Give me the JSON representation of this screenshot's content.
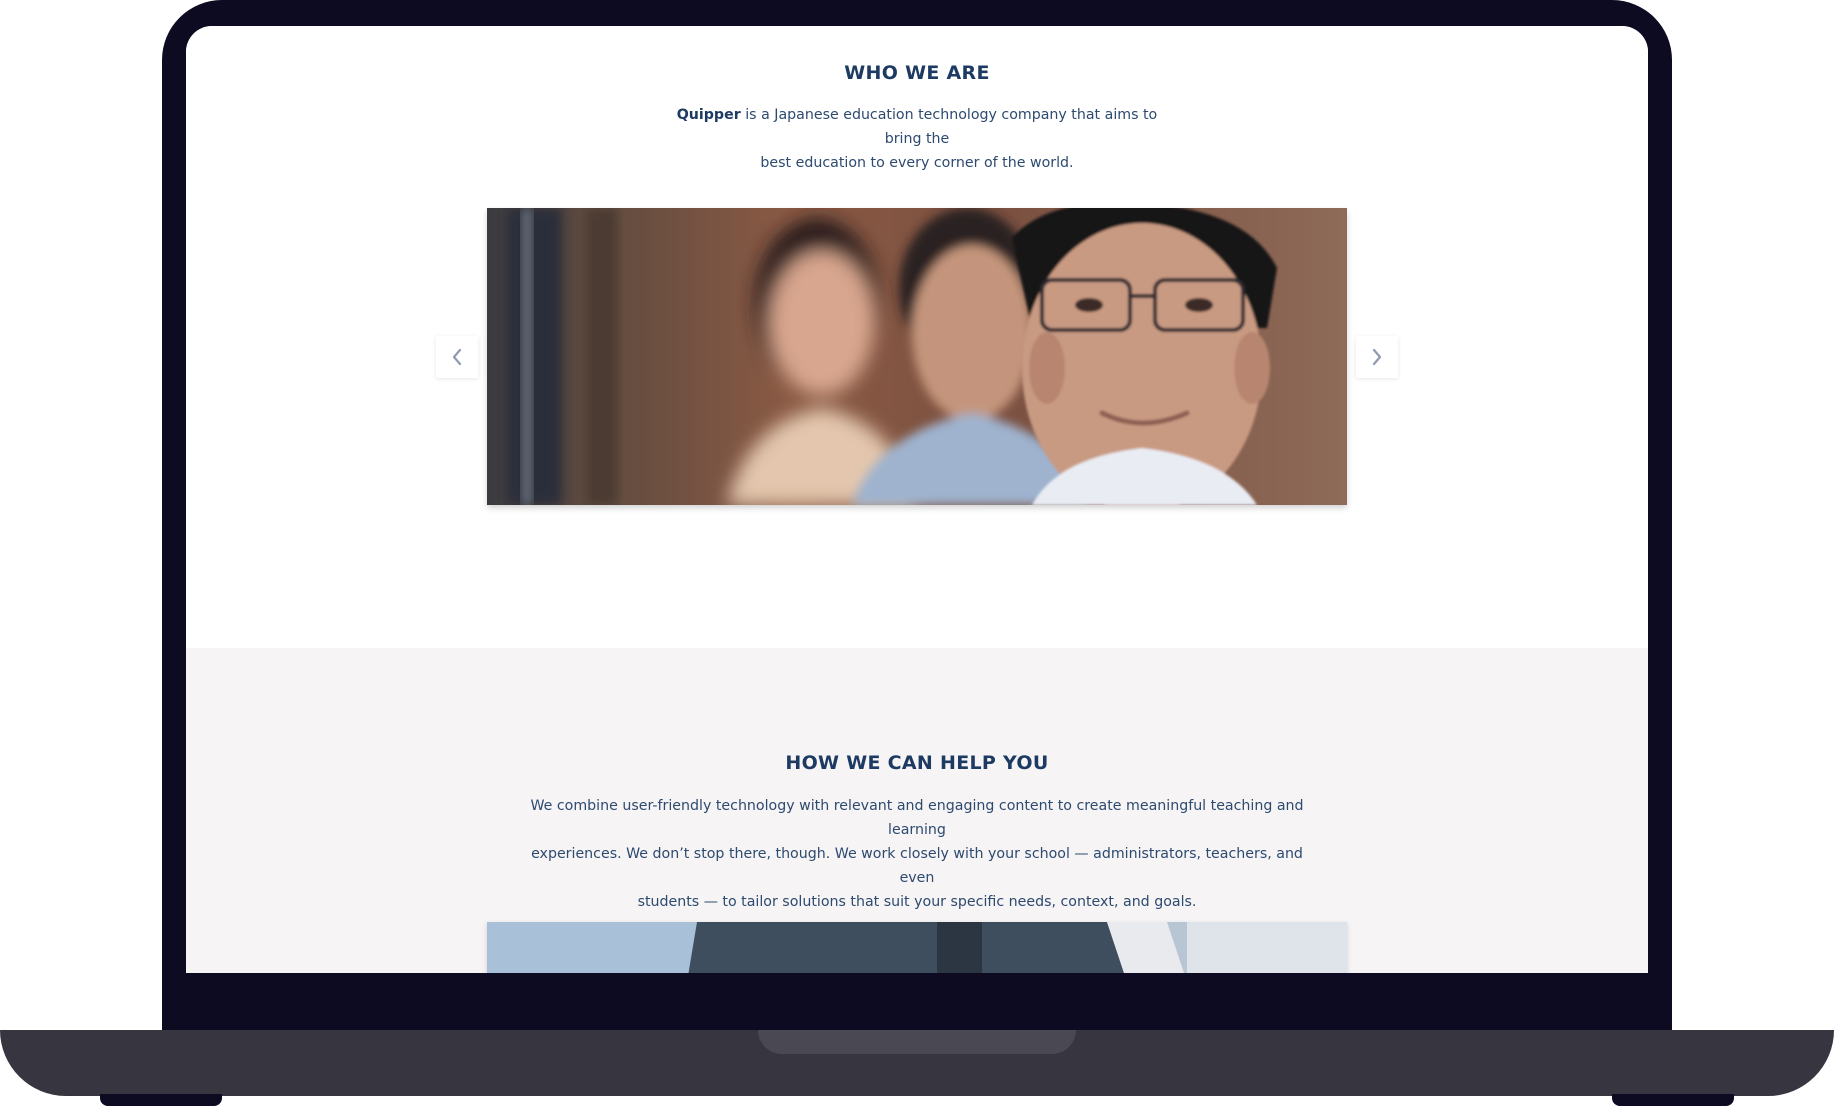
{
  "who_we_are": {
    "title": "WHO WE ARE",
    "brand": "Quipper",
    "description_line1": "is a Japanese education technology company that aims to bring the",
    "description_line2": "best education to every corner of the world.",
    "carousel": {
      "prev_icon": "chevron-left-icon",
      "next_icon": "chevron-right-icon"
    }
  },
  "how_we_help": {
    "title": "HOW WE CAN HELP YOU",
    "line1": "We combine user-friendly technology with relevant and engaging content to create meaningful teaching and learning",
    "line2": "experiences. We don’t stop there, though. We work closely with your school — administrators, teachers, and even",
    "line3": "students — to tailor solutions that suit your specific needs, context, and goals."
  },
  "colors": {
    "heading": "#1d3a63",
    "text": "#2d4a6f",
    "section_alt_bg": "#f6f4f5",
    "device_frame": "#0c0b21",
    "device_base": "#373640"
  }
}
